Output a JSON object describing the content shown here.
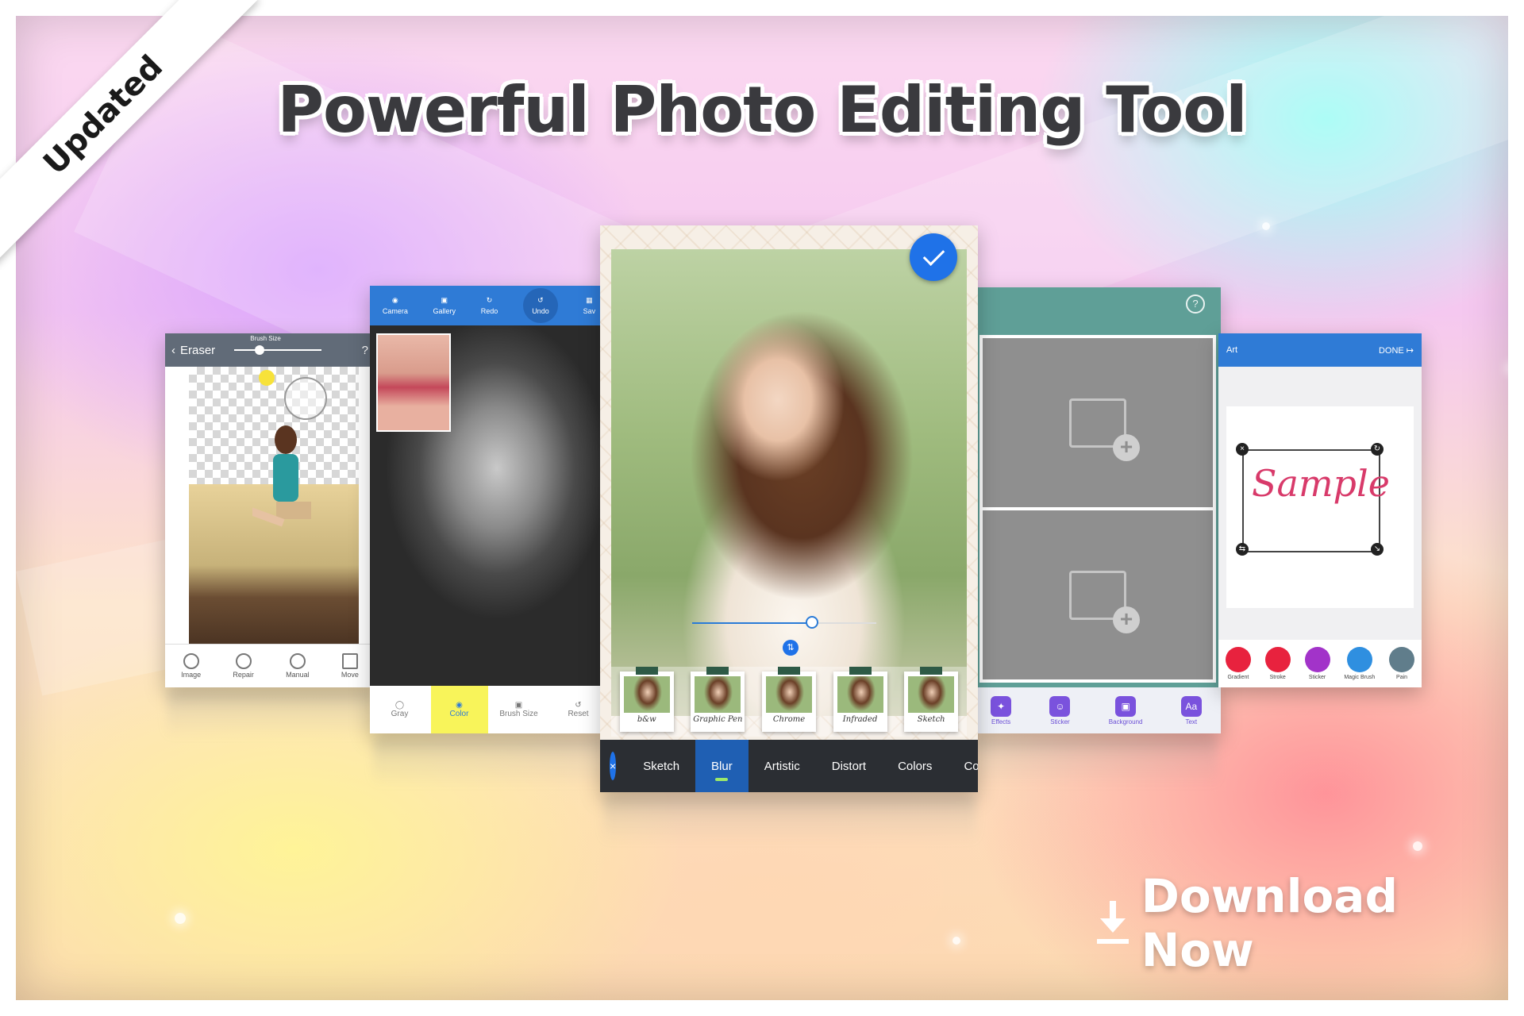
{
  "banner": {
    "badge": "Updated",
    "title": "Powerful Photo Editing Tool",
    "cta": "Download Now"
  },
  "screen_eraser": {
    "back_label": "Eraser",
    "slider_label": "Brush Size",
    "help": "?",
    "tools": [
      "Image",
      "Repair",
      "Manual",
      "Move"
    ]
  },
  "screen_color": {
    "top_buttons": [
      "Camera",
      "Gallery",
      "Redo",
      "Undo",
      "Sav"
    ],
    "bottom_tools": [
      "Gray",
      "Color",
      "Brush Size",
      "Reset"
    ],
    "active_bottom": "Color"
  },
  "screen_main": {
    "filters": [
      "b&w",
      "Graphic Pen",
      "Chrome",
      "Infraded",
      "Sketch"
    ],
    "categories": [
      "Sketch",
      "Blur",
      "Artistic",
      "Distort",
      "Colors",
      "Co"
    ],
    "active_category": "Blur",
    "slider_value": 0.65
  },
  "screen_collage": {
    "help": "?",
    "tools": [
      "Effects",
      "Sticker",
      "Background",
      "Text"
    ]
  },
  "screen_art": {
    "title": "Art",
    "done": "DONE",
    "sample_text": "Sample",
    "tools": [
      "Gradient",
      "Stroke",
      "Sticker",
      "Magic Brush",
      "Pain"
    ],
    "tool_colors": [
      "#e8223e",
      "#e8223e",
      "#a233c9",
      "#2f8fe0",
      "#607d8b"
    ]
  },
  "colors": {
    "accent": "#1f72e8",
    "bottom_bar": "#2b2e33",
    "collage_bar": "#5f9f97",
    "highlight": "#f8f45a"
  }
}
